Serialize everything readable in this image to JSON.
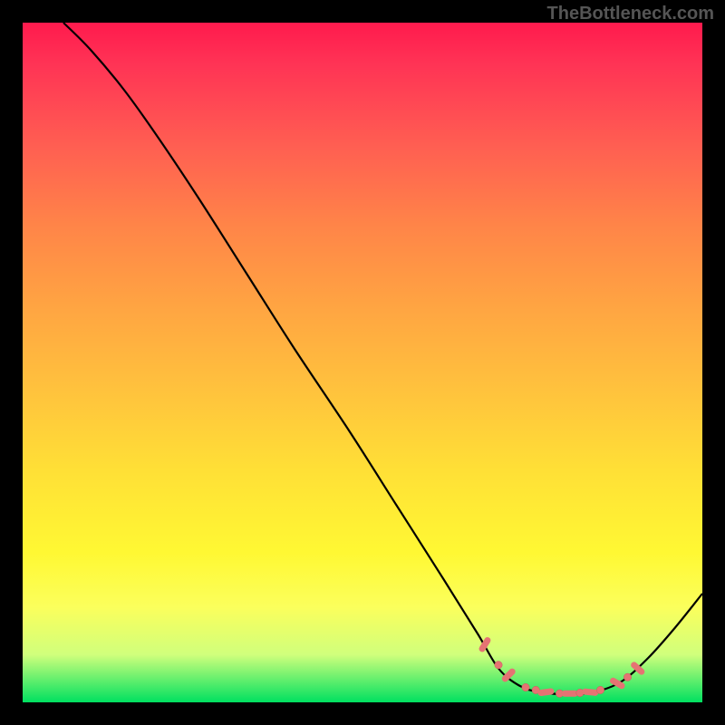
{
  "watermark": "TheBottleneck.com",
  "chart_data": {
    "type": "line",
    "title": "",
    "xlabel": "",
    "ylabel": "",
    "xlim": [
      0,
      100
    ],
    "ylim": [
      0,
      100
    ],
    "grid": false,
    "curve": [
      {
        "x": 6,
        "y": 100
      },
      {
        "x": 10,
        "y": 96
      },
      {
        "x": 15,
        "y": 90
      },
      {
        "x": 20,
        "y": 83
      },
      {
        "x": 26,
        "y": 74
      },
      {
        "x": 33,
        "y": 63
      },
      {
        "x": 40,
        "y": 52
      },
      {
        "x": 48,
        "y": 40
      },
      {
        "x": 55,
        "y": 29
      },
      {
        "x": 62,
        "y": 18
      },
      {
        "x": 67,
        "y": 10
      },
      {
        "x": 70,
        "y": 5
      },
      {
        "x": 73,
        "y": 2.5
      },
      {
        "x": 76,
        "y": 1.5
      },
      {
        "x": 80,
        "y": 1.2
      },
      {
        "x": 84,
        "y": 1.5
      },
      {
        "x": 88,
        "y": 3
      },
      {
        "x": 92,
        "y": 6.5
      },
      {
        "x": 96,
        "y": 11
      },
      {
        "x": 100,
        "y": 16
      }
    ],
    "markers": [
      {
        "x": 68,
        "y": 8.5,
        "type": "dash",
        "angle": -58
      },
      {
        "x": 70,
        "y": 5.5,
        "type": "dot"
      },
      {
        "x": 71.5,
        "y": 4,
        "type": "dash",
        "angle": -45
      },
      {
        "x": 74,
        "y": 2.2,
        "type": "dot"
      },
      {
        "x": 75.5,
        "y": 1.8,
        "type": "dot"
      },
      {
        "x": 77,
        "y": 1.5,
        "type": "dash",
        "angle": -8
      },
      {
        "x": 79,
        "y": 1.3,
        "type": "dot"
      },
      {
        "x": 80.5,
        "y": 1.3,
        "type": "dash",
        "angle": 0
      },
      {
        "x": 82,
        "y": 1.4,
        "type": "dot"
      },
      {
        "x": 83.5,
        "y": 1.5,
        "type": "dash",
        "angle": 6
      },
      {
        "x": 85,
        "y": 1.8,
        "type": "dot"
      },
      {
        "x": 87.5,
        "y": 2.8,
        "type": "dash",
        "angle": 30
      },
      {
        "x": 89,
        "y": 3.7,
        "type": "dot"
      },
      {
        "x": 90.5,
        "y": 5,
        "type": "dash",
        "angle": 42
      }
    ],
    "background_gradient": {
      "top_color": "#ff1a4d",
      "bottom_color": "#00e060"
    }
  }
}
